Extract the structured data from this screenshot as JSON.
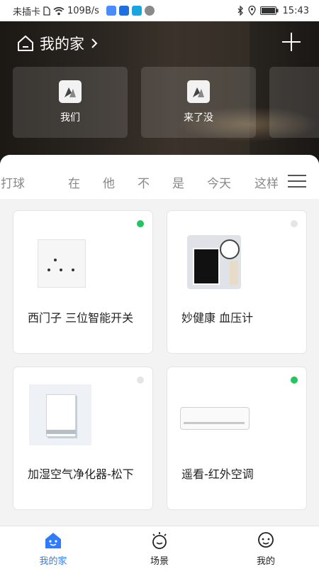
{
  "status_bar": {
    "carrier": "未插卡",
    "speed": "109B/s",
    "time": "15:43"
  },
  "header": {
    "home_name": "我的家",
    "home_icon": "home-icon",
    "add_icon": "plus-icon"
  },
  "scenes": [
    {
      "label": "我们",
      "icon": "scene-icon"
    },
    {
      "label": "来了没",
      "icon": "scene-icon"
    }
  ],
  "room_tabs": [
    {
      "label": "在打球"
    },
    {
      "label": "在"
    },
    {
      "label": "他"
    },
    {
      "label": "不"
    },
    {
      "label": "是"
    },
    {
      "label": "今天"
    },
    {
      "label": "这样"
    }
  ],
  "devices": [
    {
      "name": "西门子 三位智能开关",
      "status_color": "#22c55e",
      "icon": "switch-image"
    },
    {
      "name": "妙健康 血压计",
      "status_color": "#e5e5e5",
      "icon": "blood-pressure-monitor-image"
    },
    {
      "name": "加湿空气净化器-松下",
      "status_color": "#e5e5e5",
      "icon": "air-purifier-image"
    },
    {
      "name": "遥看-红外空调",
      "status_color": "#22c55e",
      "icon": "air-conditioner-image"
    }
  ],
  "bottom_nav": [
    {
      "label": "我的家",
      "icon": "home-nav-icon",
      "active": true,
      "color": "#2f7bff"
    },
    {
      "label": "场景",
      "icon": "scene-nav-icon",
      "active": false
    },
    {
      "label": "我的",
      "icon": "profile-nav-icon",
      "active": false
    }
  ]
}
